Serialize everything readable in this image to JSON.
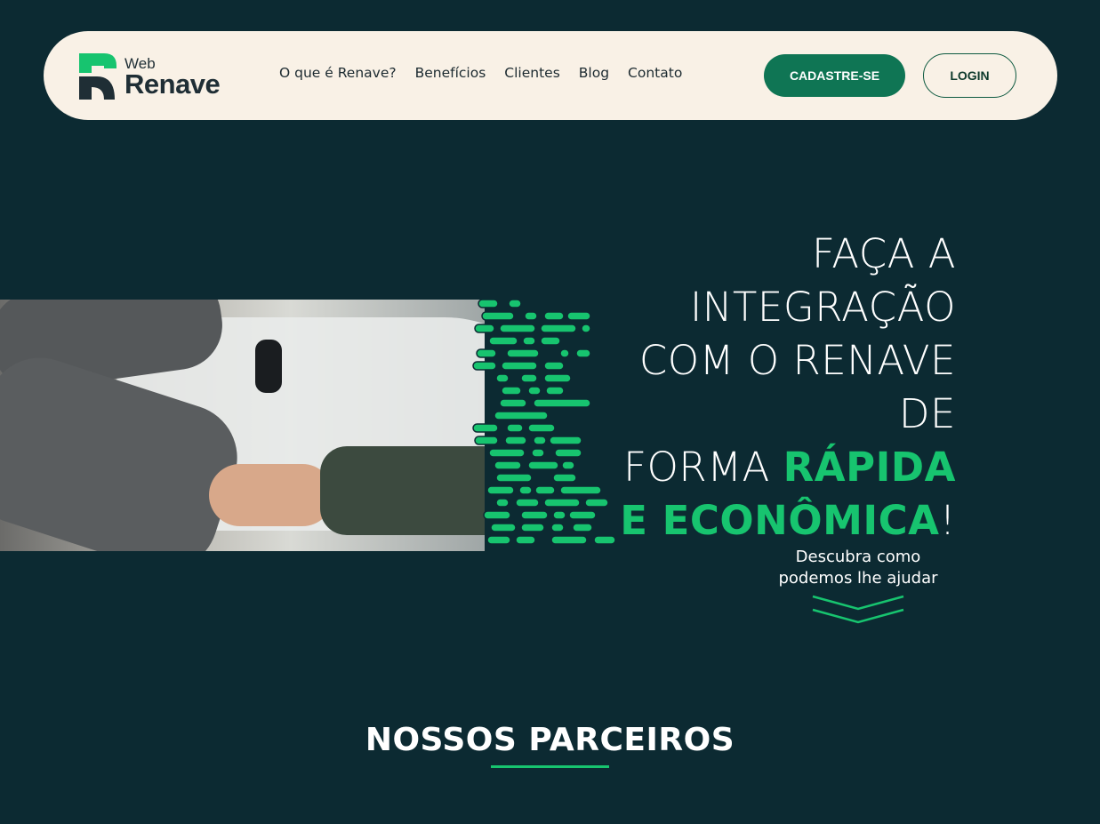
{
  "header": {
    "logo": {
      "small": "Web",
      "big": "Renave"
    },
    "nav": [
      "O que é Renave?",
      "Benefícios",
      "Clientes",
      "Blog",
      "Contato"
    ],
    "signup_label": "CADASTRE-SE",
    "login_label": "LOGIN"
  },
  "hero": {
    "title_lines": [
      "FAÇA A",
      "INTEGRAÇÃO",
      "COM O RENAVE",
      "DE"
    ],
    "title_forma": "FORMA ",
    "title_rapida": "RÁPIDA",
    "title_economica": "E ECONÔMICA",
    "title_excl": "!",
    "subtitle_line1": "Descubra como",
    "subtitle_line2": "podemos lhe ajudar"
  },
  "partners": {
    "title": "NOSSOS PARCEIROS"
  },
  "colors": {
    "background": "#0c2a32",
    "accent": "#17c46f",
    "nav_bg": "#f9f1e6",
    "button": "#0f7554"
  }
}
